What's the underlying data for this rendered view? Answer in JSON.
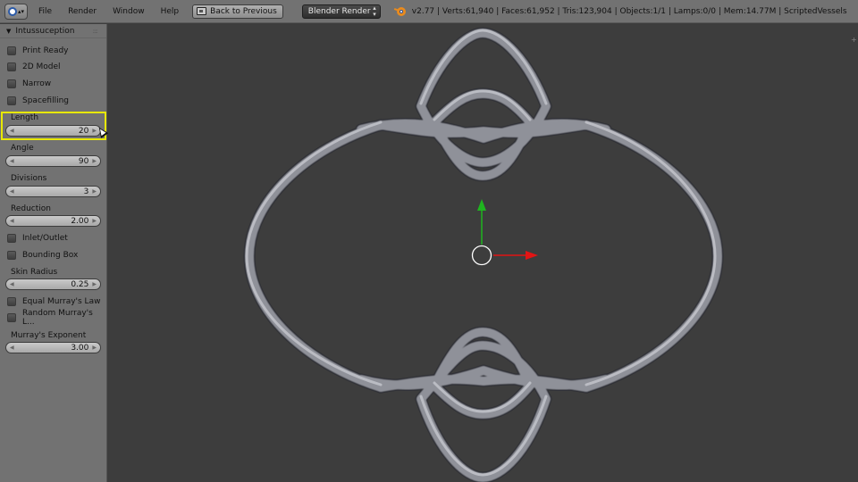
{
  "header": {
    "menus": [
      "File",
      "Render",
      "Window",
      "Help"
    ],
    "back_button": "Back to Previous",
    "render_engine": "Blender Render",
    "stats": "v2.77 | Verts:61,940 | Faces:61,952 | Tris:123,904 | Objects:1/1 | Lamps:0/0 | Mem:14.77M | ScriptedVessels"
  },
  "panel": {
    "title": "Intussuception",
    "print_ready": "Print Ready",
    "model_2d": "2D Model",
    "narrow": "Narrow",
    "spacefilling": "Spacefilling",
    "length_label": "Length",
    "length_value": "20",
    "angle_label": "Angle",
    "angle_value": "90",
    "divisions_label": "Divisions",
    "divisions_value": "3",
    "reduction_label": "Reduction",
    "reduction_value": "2.00",
    "inlet_outlet": "Inlet/Outlet",
    "bounding_box": "Bounding Box",
    "skin_radius_label": "Skin Radius",
    "skin_radius_value": "0.25",
    "equal_murray": "Equal Murray's Law",
    "random_murray": "Random Murray's L...",
    "murray_exp_label": "Murray's Exponent",
    "murray_exp_value": "3.00"
  },
  "colors": {
    "axis_y": "#1fb51f",
    "axis_x": "#e21414",
    "highlight": "#e8e800",
    "vessel": "#8f9199"
  }
}
